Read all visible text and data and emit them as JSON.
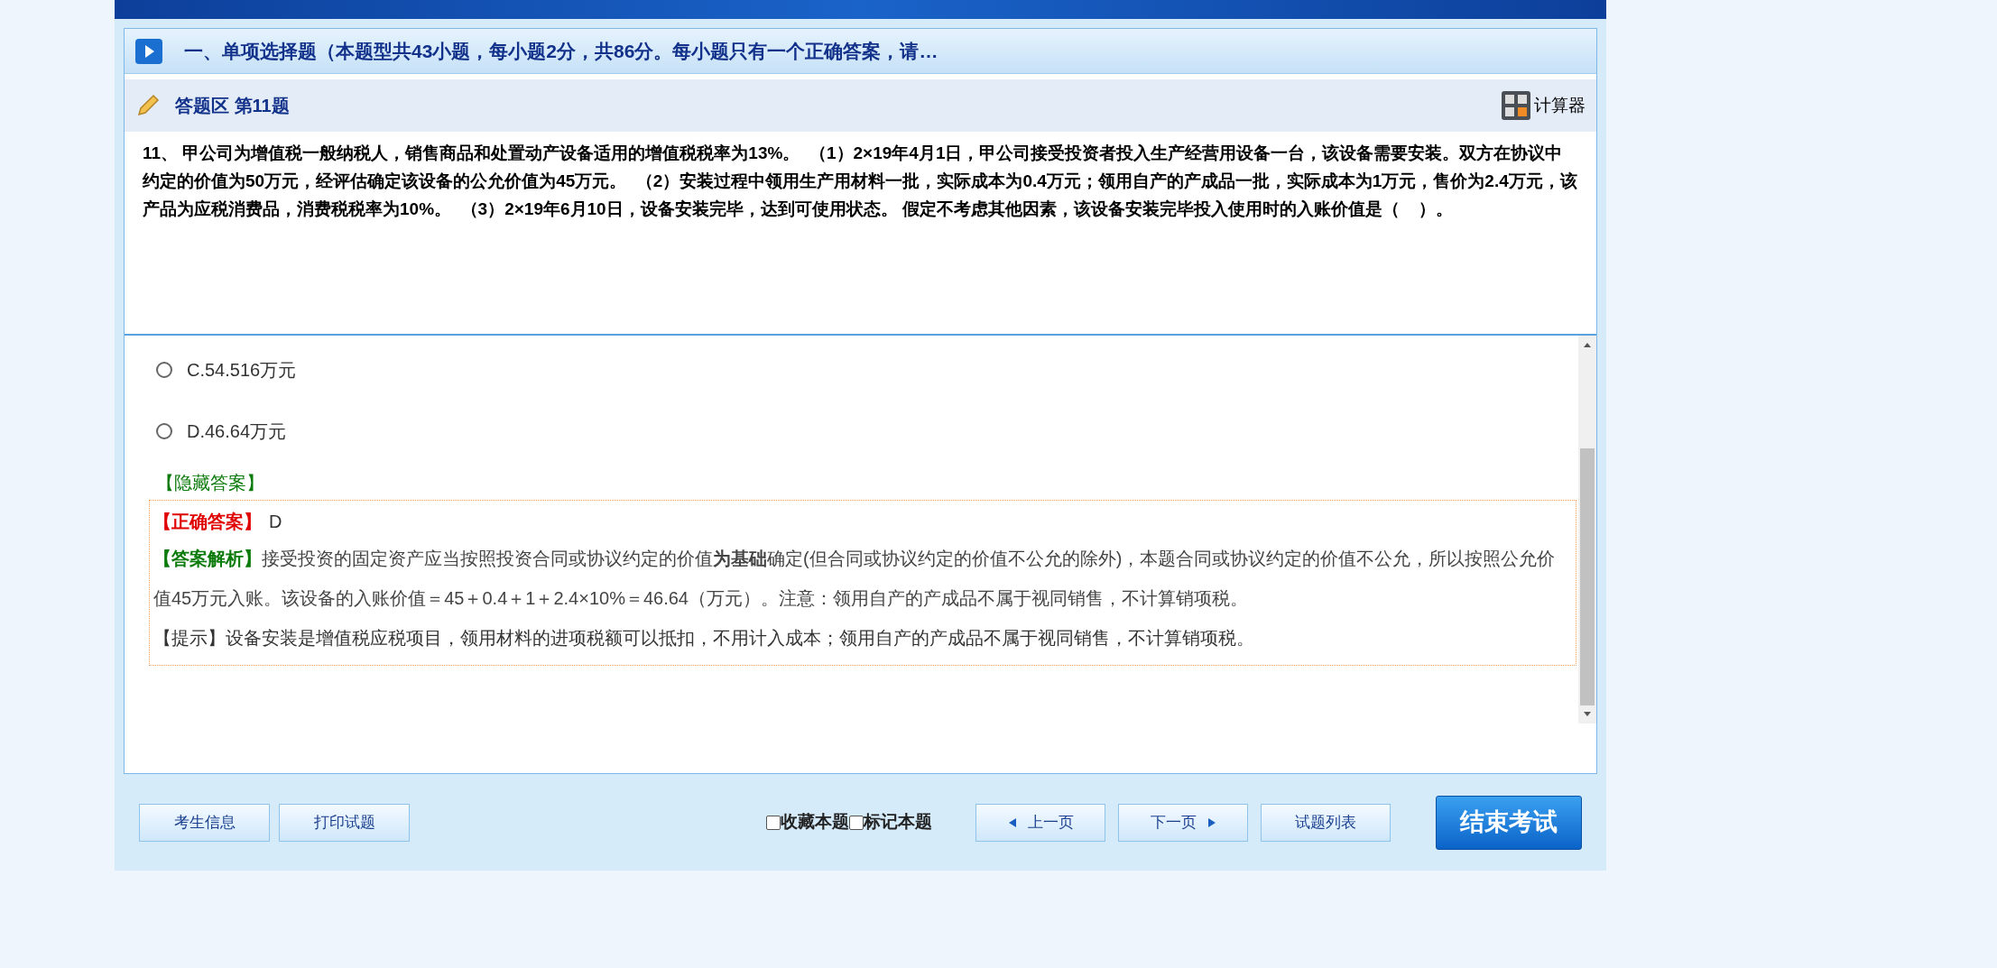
{
  "section_title": "一、单项选择题（本题型共43小题，每小题2分，共86分。每小题只有一个正确答案，请…",
  "answer_area": {
    "label": "答题区 第11题",
    "calculator": "计算器"
  },
  "question": "11、 甲公司为增值税一般纳税人，销售商品和处置动产设备适用的增值税税率为13%。  （1）2×19年4月1日，甲公司接受投资者投入生产经营用设备一台，该设备需要安装。双方在协议中约定的价值为50万元，经评估确定该设备的公允价值为45万元。  （2）安装过程中领用生产用材料一批，实际成本为0.4万元；领用自产的产成品一批，实际成本为1万元，售价为2.4万元，该产品为应税消费品，消费税税率为10%。  （3）2×19年6月10日，设备安装完毕，达到可使用状态。 假定不考虑其他因素，该设备安装完毕投入使用时的入账价值是（    ）。",
  "options": [
    {
      "label": "C.54.516万元",
      "selected": false
    },
    {
      "label": "D.46.64万元",
      "selected": false
    }
  ],
  "answer": {
    "toggle": "【隐藏答案】",
    "correct_label": "【正确答案】",
    "correct_value": "D",
    "analysis_label": "【答案解析】",
    "analysis_text": "接受投资的固定资产应当按照投资合同或协议约定的价值**为基础**确定(但合同或协议约定的价值不公允的除外)，本题合同或协议约定的价值不公允，所以按照公允价值45万元入账。该设备的入账价值＝45＋0.4＋1＋2.4×10%＝46.64（万元）。注意：领用自产的产成品不属于视同销售，不计算销项税。",
    "hint": "【提示】设备安装是增值税应税项目，领用材料的进项税额可以抵扣，不用计入成本；领用自产的产成品不属于视同销售，不计算销项税。"
  },
  "footer": {
    "left_buttons": [
      "考生信息",
      "打印试题"
    ],
    "checkboxes": [
      {
        "label": "收藏本题",
        "checked": false
      },
      {
        "label": "标记本题",
        "checked": false
      }
    ],
    "prev": "上一页",
    "next": "下一页",
    "list": "试题列表",
    "finish": "结束考试"
  }
}
